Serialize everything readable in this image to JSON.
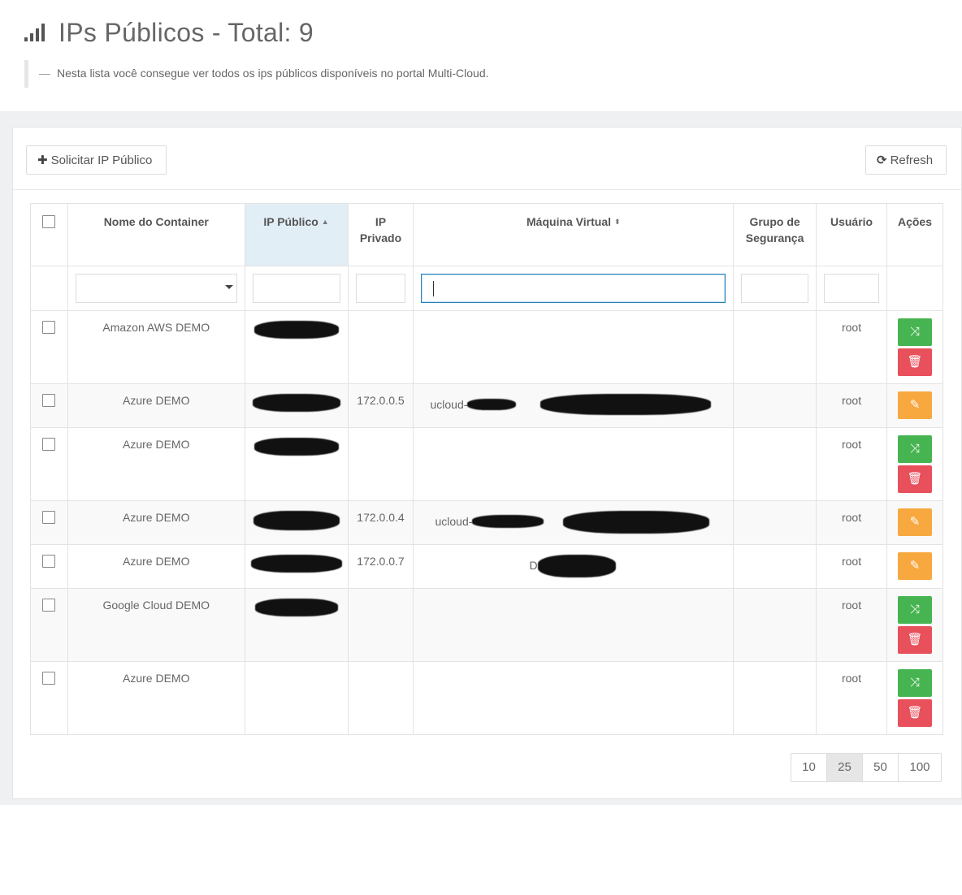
{
  "header": {
    "title": "IPs Públicos - Total: 9",
    "icon": "signal-icon",
    "subtitle_dash": "—",
    "subtitle": "Nesta lista você consegue ver todos os ips públicos disponíveis no portal Multi-Cloud."
  },
  "toolbar": {
    "solicitar_label": "Solicitar IP Público",
    "refresh_label": "Refresh"
  },
  "table": {
    "columns": {
      "container": "Nome do Container",
      "ip_publico": "IP Público",
      "ip_privado": "IP Privado",
      "maquina": "Máquina Virtual",
      "grupo": "Grupo de Segurança",
      "usuario": "Usuário",
      "acoes": "Ações"
    },
    "rows": [
      {
        "container": "Amazon AWS DEMO",
        "ip_privado": "",
        "vm": "",
        "usuario": "root"
      },
      {
        "container": "Azure DEMO",
        "ip_privado": "172.0.0.5",
        "vm": "ucloud-",
        "usuario": "root"
      },
      {
        "container": "Azure DEMO",
        "ip_privado": "",
        "vm": "",
        "usuario": "root"
      },
      {
        "container": "Azure DEMO",
        "ip_privado": "172.0.0.4",
        "vm": "ucloud-",
        "usuario": "root"
      },
      {
        "container": "Azure DEMO",
        "ip_privado": "172.0.0.7",
        "vm": "D",
        "usuario": "root"
      },
      {
        "container": "Google Cloud DEMO",
        "ip_privado": "",
        "vm": "",
        "usuario": "root"
      },
      {
        "container": "Azure DEMO",
        "ip_privado": "",
        "vm": "",
        "usuario": "root"
      }
    ]
  },
  "pagination": {
    "sizes": [
      "10",
      "25",
      "50",
      "100"
    ],
    "active": "25"
  },
  "colors": {
    "green": "#46b450",
    "red": "#e8505b",
    "orange": "#f7a940",
    "sorted_header": "#e2eef6"
  }
}
